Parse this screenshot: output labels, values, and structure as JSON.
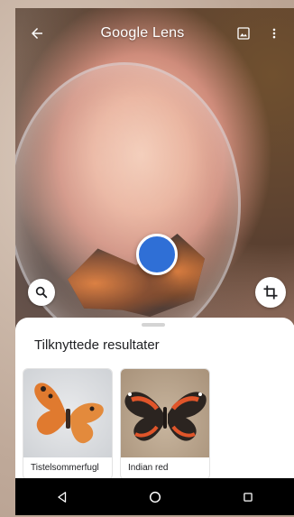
{
  "app": {
    "title": "Google Lens"
  },
  "toolbar": {
    "back_icon": "arrow-left-icon",
    "gallery_icon": "image-icon",
    "more_icon": "more-vert-icon"
  },
  "camera": {
    "shutter_color": "#2f6fd6",
    "search_icon": "search-icon",
    "crop_icon": "crop-icon"
  },
  "sheet": {
    "title": "Tilknyttede resultater",
    "results": [
      {
        "label": "Tistelsommerfugl"
      },
      {
        "label": "Indian red"
      }
    ]
  },
  "navbar": {
    "back_icon": "nav-back-icon",
    "home_icon": "nav-home-icon",
    "recents_icon": "nav-recents-icon"
  }
}
